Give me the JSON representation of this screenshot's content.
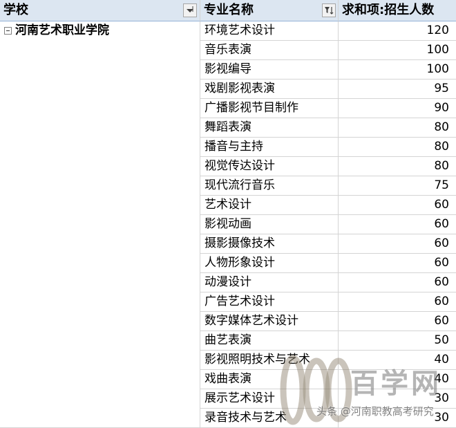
{
  "headers": {
    "school": "学校",
    "major": "专业名称",
    "sum": "求和项:招生人数"
  },
  "school_name": "河南艺术职业学院",
  "rows": [
    {
      "major": "环境艺术设计",
      "count": "120"
    },
    {
      "major": "音乐表演",
      "count": "100"
    },
    {
      "major": "影视编导",
      "count": "100"
    },
    {
      "major": "戏剧影视表演",
      "count": "95"
    },
    {
      "major": "广播影视节目制作",
      "count": "90"
    },
    {
      "major": "舞蹈表演",
      "count": "80"
    },
    {
      "major": "播音与主持",
      "count": "80"
    },
    {
      "major": "视觉传达设计",
      "count": "80"
    },
    {
      "major": "现代流行音乐",
      "count": "75"
    },
    {
      "major": "艺术设计",
      "count": "60"
    },
    {
      "major": "影视动画",
      "count": "60"
    },
    {
      "major": "摄影摄像技术",
      "count": "60"
    },
    {
      "major": "人物形象设计",
      "count": "60"
    },
    {
      "major": "动漫设计",
      "count": "60"
    },
    {
      "major": "广告艺术设计",
      "count": "60"
    },
    {
      "major": "数字媒体艺术设计",
      "count": "60"
    },
    {
      "major": "曲艺表演",
      "count": "50"
    },
    {
      "major": "影视照明技术与艺术",
      "count": "40"
    },
    {
      "major": "戏曲表演",
      "count": "40"
    },
    {
      "major": "展示艺术设计",
      "count": "30"
    },
    {
      "major": "录音技术与艺术",
      "count": "30"
    }
  ],
  "watermark": {
    "brand": "百学网",
    "source": "头条 @河南职教高考研究"
  },
  "colors": {
    "header_bg": "#dce6f1",
    "gridline": "#d4d4d4"
  },
  "icons": {
    "school_filter": "dropdown-sort-icon",
    "major_filter": "filter-sort-icon",
    "collapse": "minus-box-icon"
  }
}
